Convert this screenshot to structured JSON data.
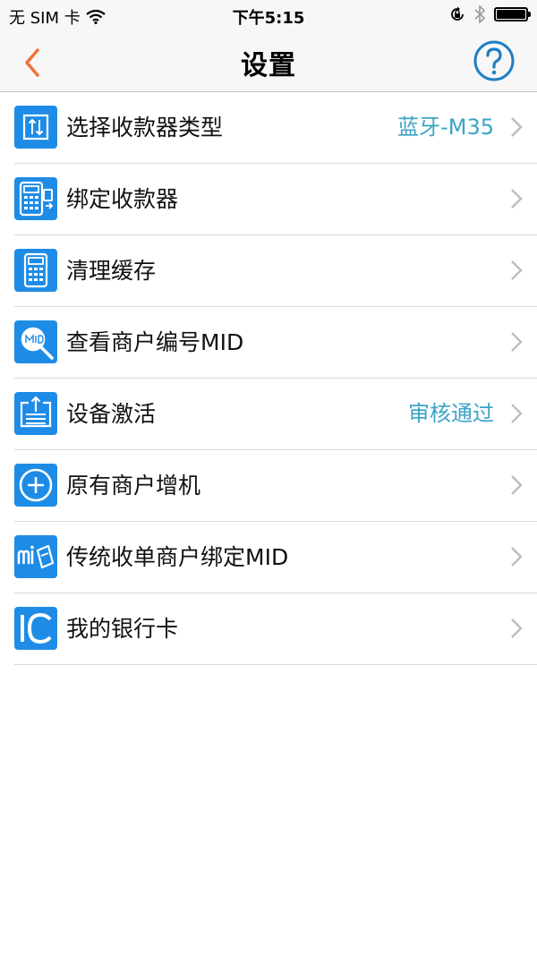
{
  "status_bar": {
    "carrier": "无 SIM 卡",
    "time": "下午5:15"
  },
  "nav": {
    "title": "设置"
  },
  "colors": {
    "accent_blue": "#1e8ce6",
    "value_text": "#3aa3c6",
    "back_orange": "#f0703a"
  },
  "items": [
    {
      "label": "选择收款器类型",
      "value": "蓝牙-M35",
      "icon": "swap-arrows-icon"
    },
    {
      "label": "绑定收款器",
      "value": "",
      "icon": "card-reader-icon"
    },
    {
      "label": "清理缓存",
      "value": "",
      "icon": "calculator-icon"
    },
    {
      "label": "查看商户编号MID",
      "value": "",
      "icon": "mid-search-icon"
    },
    {
      "label": "设备激活",
      "value": "审核通过",
      "icon": "upload-tray-icon"
    },
    {
      "label": "原有商户增机",
      "value": "",
      "icon": "plus-circle-icon"
    },
    {
      "label": "传统收单商户绑定MID",
      "value": "",
      "icon": "mid-badge-icon"
    },
    {
      "label": "我的银行卡",
      "value": "",
      "icon": "ic-card-icon"
    }
  ]
}
